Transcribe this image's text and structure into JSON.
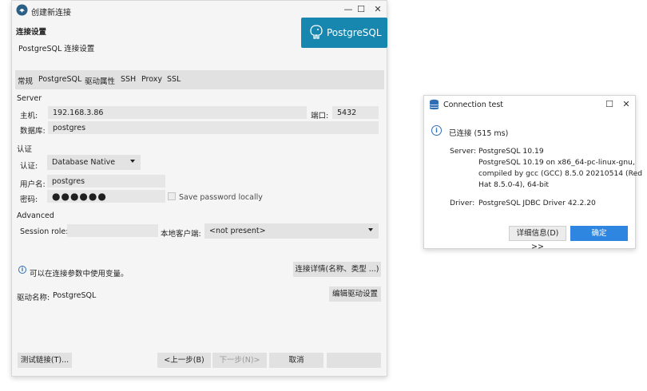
{
  "main_dialog": {
    "title": "创建新连接",
    "window_controls": {
      "minimize": "—",
      "maximize": "☐",
      "close": "✕"
    },
    "section_title": "连接设置",
    "subtitle": "PostgreSQL 连接设置",
    "banner_text": "PostgreSQL",
    "tabs": [
      "常规",
      "PostgreSQL",
      "驱动属性",
      "SSH",
      "Proxy",
      "SSL"
    ],
    "server_section": {
      "label": "Server",
      "host_label": "主机:",
      "host_value": "192.168.3.86",
      "port_label": "端口:",
      "port_value": "5432",
      "database_label": "数据库:",
      "database_value": "postgres"
    },
    "auth_section": {
      "label": "认证",
      "auth_label": "认证:",
      "auth_value": "Database Native",
      "username_label": "用户名:",
      "username_value": "postgres",
      "password_label": "密码:",
      "password_value": "●●●●●●",
      "save_password_label": "Save password locally"
    },
    "advanced_section": {
      "label": "Advanced",
      "session_role_label": "Session role:",
      "session_role_value": "",
      "local_client_label": "本地客户端:",
      "local_client_value": "<not present>"
    },
    "info_text": "可以在连接参数中使用变量。",
    "connection_details_button": "连接详情(名称、类型 ...)",
    "driver_name_label": "驱动名称:",
    "driver_name_value": "PostgreSQL",
    "edit_driver_button": "编辑驱动设置",
    "footer": {
      "test_button": "测试链接(T)...",
      "prev_button": "<上一步(B)",
      "next_button": "下一步(N)>",
      "cancel_button": "取消",
      "finish_button": ""
    }
  },
  "conn_dialog": {
    "title": "Connection test",
    "window_controls": {
      "maximize": "☐",
      "close": "✕"
    },
    "status": "已连接 (515 ms)",
    "server_label": "Server:",
    "server_lines": [
      "PostgreSQL 10.19",
      "PostgreSQL 10.19 on x86_64-pc-linux-gnu,",
      "compiled by gcc (GCC) 8.5.0 20210514 (Red",
      "Hat 8.5.0-4), 64-bit"
    ],
    "driver_label": "Driver:",
    "driver_value": "PostgreSQL JDBC Driver 42.2.20",
    "details_button": "详细信息(D) >>",
    "ok_button": "确定"
  },
  "colors": {
    "accent": "#2f86e0",
    "banner": "#1787b0",
    "dialog_bg": "#f5f5f5",
    "field_bg": "#e6e6e6"
  },
  "icons": [
    "app-logo-icon",
    "elephant-icon",
    "database-icon",
    "info-icon",
    "chevron-down-icon"
  ]
}
